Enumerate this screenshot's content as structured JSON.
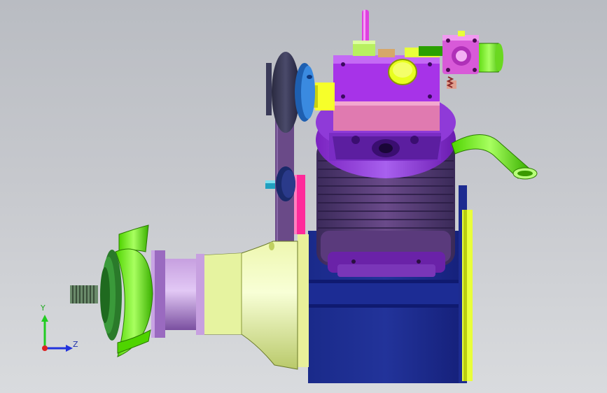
{
  "viewport": {
    "background_top": "#b9bcc2",
    "background_bottom": "#d9dbde"
  },
  "triad": {
    "y_label": "Y",
    "z_label": "Z",
    "y_color": "#22cc22",
    "z_color": "#2233dd",
    "x_color": "#dd2222"
  },
  "model": {
    "parts": [
      "propeller",
      "prop-shaft-thread",
      "prop-hub",
      "drive-housing-cone",
      "crankcase",
      "cylinder-fins",
      "cylinder-head",
      "carburetor",
      "intake-pipe",
      "exhaust-pipe",
      "belt-pulley-upper",
      "belt-pulley-lower",
      "drive-belt",
      "fuel-nipple"
    ]
  }
}
